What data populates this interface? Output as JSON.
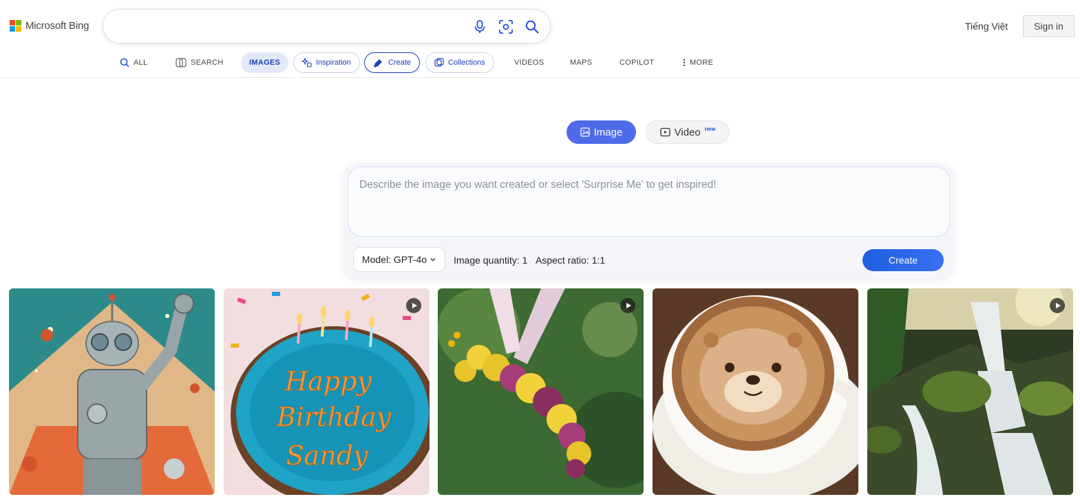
{
  "header": {
    "logo_text": "Microsoft Bing",
    "language": "Tiếng Việt",
    "signin_label": "Sign in",
    "search_value": ""
  },
  "nav": {
    "all": "ALL",
    "search": "SEARCH",
    "images": "IMAGES",
    "inspiration": "Inspiration",
    "create": "Create",
    "collections": "Collections",
    "videos": "VIDEOS",
    "maps": "MAPS",
    "copilot": "COPILOT",
    "more": "MORE"
  },
  "mode": {
    "image_label": "Image",
    "video_label": "Video",
    "video_badge": "new"
  },
  "prompt": {
    "placeholder": "Describe the image you want created or select 'Surprise Me' to get inspired!",
    "model_label": "Model: GPT-4o",
    "quantity_label": "Image quantity: 1",
    "ratio_label": "Aspect ratio: 1:1",
    "create_label": "Create"
  },
  "gallery": [
    {
      "subject": "retro robot",
      "has_video": false
    },
    {
      "subject": "birthday cake",
      "cake_text_1": "Happy",
      "cake_text_2": "Birthday",
      "cake_text_3": "Sandy",
      "has_video": true
    },
    {
      "subject": "flower caterpillar",
      "has_video": true
    },
    {
      "subject": "otter latte",
      "has_video": false
    },
    {
      "subject": "waterfall",
      "has_video": true
    }
  ],
  "colors": {
    "accent": "#4f6bea",
    "create_button": "#1f5fe0",
    "link_blue": "#1a3fb8"
  }
}
